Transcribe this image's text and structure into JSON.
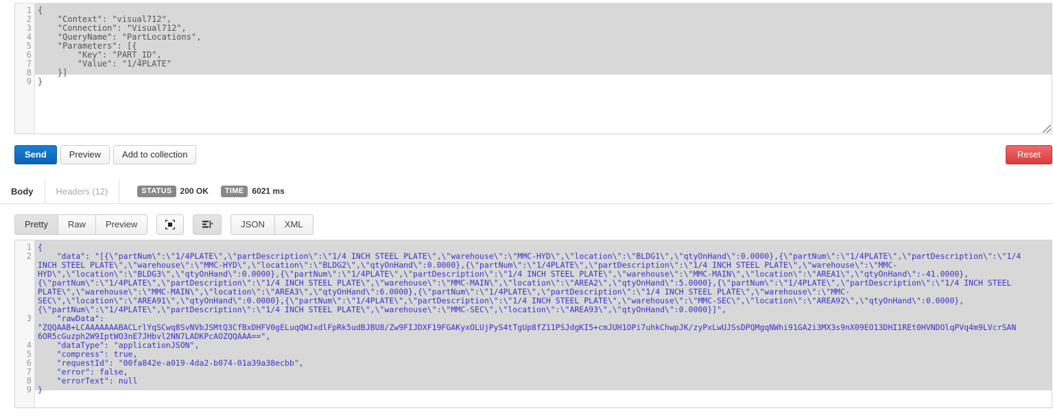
{
  "request_editor": {
    "gutter": [
      "1",
      "2",
      "3",
      "4",
      "5",
      "6",
      "7",
      "8",
      "9"
    ],
    "lines": [
      "{",
      "    \"Context\": \"visual712\",",
      "    \"Connection\": \"Visual712\",",
      "    \"QueryName\": \"PartLocations\",",
      "    \"Parameters\": [{",
      "        \"Key\": \"PART_ID\",",
      "        \"Value\": \"1/4PLATE\"",
      "    }]",
      "}"
    ],
    "resize_handle": "resize-grip"
  },
  "actions": {
    "send_label": "Send",
    "preview_label": "Preview",
    "add_to_collection_label": "Add to collection",
    "reset_label": "Reset",
    "send_color": "#0b63b5",
    "reset_color": "#d93b3b"
  },
  "response_tabs": {
    "body_label": "Body",
    "headers_label": "Headers (12)",
    "status_chip": "STATUS",
    "status_value": "200 OK",
    "time_chip": "TIME",
    "time_value": "6021 ms"
  },
  "format_toolbar": {
    "pretty_label": "Pretty",
    "raw_label": "Raw",
    "preview_label": "Preview",
    "fullscreen_icon": "maximize-icon",
    "wrap_icon": "wrap-lines-icon",
    "json_label": "JSON",
    "xml_label": "XML"
  },
  "response_editor": {
    "gutter": [
      {
        "n": "1",
        "blanks": 0
      },
      {
        "n": "2",
        "blanks": 6
      },
      {
        "n": "3",
        "blanks": 2
      },
      {
        "n": "4",
        "blanks": 0
      },
      {
        "n": "5",
        "blanks": 0
      },
      {
        "n": "6",
        "blanks": 0
      },
      {
        "n": "7",
        "blanks": 0
      },
      {
        "n": "8",
        "blanks": 0
      },
      {
        "n": "9",
        "blanks": 0
      }
    ],
    "lines": [
      "{",
      "    \"data\": \"[{\\\"partNum\\\":\\\"1/4PLATE\\\",\\\"partDescription\\\":\\\"1/4 INCH STEEL PLATE\\\",\\\"warehouse\\\":\\\"MMC-HYD\\\",\\\"location\\\":\\\"BLDG1\\\",\\\"qtyOnHand\\\":0.0000},{\\\"partNum\\\":\\\"1/4PLATE\\\",\\\"partDescription\\\":\\\"1/4",
      "INCH STEEL PLATE\\\",\\\"warehouse\\\":\\\"MMC-HYD\\\",\\\"location\\\":\\\"BLDG2\\\",\\\"qtyOnHand\\\":0.0000},{\\\"partNum\\\":\\\"1/4PLATE\\\",\\\"partDescription\\\":\\\"1/4 INCH STEEL PLATE\\\",\\\"warehouse\\\":\\\"MMC-",
      "HYD\\\",\\\"location\\\":\\\"BLDG3\\\",\\\"qtyOnHand\\\":0.0000},{\\\"partNum\\\":\\\"1/4PLATE\\\",\\\"partDescription\\\":\\\"1/4 INCH STEEL PLATE\\\",\\\"warehouse\\\":\\\"MMC-MAIN\\\",\\\"location\\\":\\\"AREA1\\\",\\\"qtyOnHand\\\":-41.0000},",
      "{\\\"partNum\\\":\\\"1/4PLATE\\\",\\\"partDescription\\\":\\\"1/4 INCH STEEL PLATE\\\",\\\"warehouse\\\":\\\"MMC-MAIN\\\",\\\"location\\\":\\\"AREA2\\\",\\\"qtyOnHand\\\":5.0000},{\\\"partNum\\\":\\\"1/4PLATE\\\",\\\"partDescription\\\":\\\"1/4 INCH STEEL",
      "PLATE\\\",\\\"warehouse\\\":\\\"MMC-MAIN\\\",\\\"location\\\":\\\"AREA3\\\",\\\"qtyOnHand\\\":6.0000},{\\\"partNum\\\":\\\"1/4PLATE\\\",\\\"partDescription\\\":\\\"1/4 INCH STEEL PLATE\\\",\\\"warehouse\\\":\\\"MMC-",
      "SEC\\\",\\\"location\\\":\\\"AREA91\\\",\\\"qtyOnHand\\\":0.0000},{\\\"partNum\\\":\\\"1/4PLATE\\\",\\\"partDescription\\\":\\\"1/4 INCH STEEL PLATE\\\",\\\"warehouse\\\":\\\"MMC-SEC\\\",\\\"location\\\":\\\"AREA92\\\",\\\"qtyOnHand\\\":0.0000},",
      "{\\\"partNum\\\":\\\"1/4PLATE\\\",\\\"partDescription\\\":\\\"1/4 INCH STEEL PLATE\\\",\\\"warehouse\\\":\\\"MMC-SEC\\\",\\\"location\\\":\\\"AREA93\\\",\\\"qtyOnHand\\\":0.0000}]\",",
      "    \"rawData\":",
      "\"ZQQAAB+LCAAAAAAABACLrlYqSCwq8SvNVbJSMtQ3CfBxDHFV0gELuqQWJxdlFpRk5udBJBU8/Zw9FIJDXF19FGAKyxOLUjPyS4tTgUp8fZ11PSJdgKI5+cmJUH1OPi7uhkChwpJK/zyPxLwUJSsDPQMgqNWhi91GA2i3MX3s9nX09EO13DHI1REt0HVNDOlqPVq4m9LVcrSAN",
      "6OR5cGuzph2W9IptWO3nE7JHbvl2NN7LADKPcAOZQQAAA==\",",
      "    \"dataType\": \"applicationJSON\",",
      "    \"compress\": true,",
      "    \"requestId\": \"00fa842e-a019-4da2-b074-01a39a38ecbb\",",
      "    \"error\": false,",
      "    \"errorText\": null",
      "}"
    ]
  }
}
